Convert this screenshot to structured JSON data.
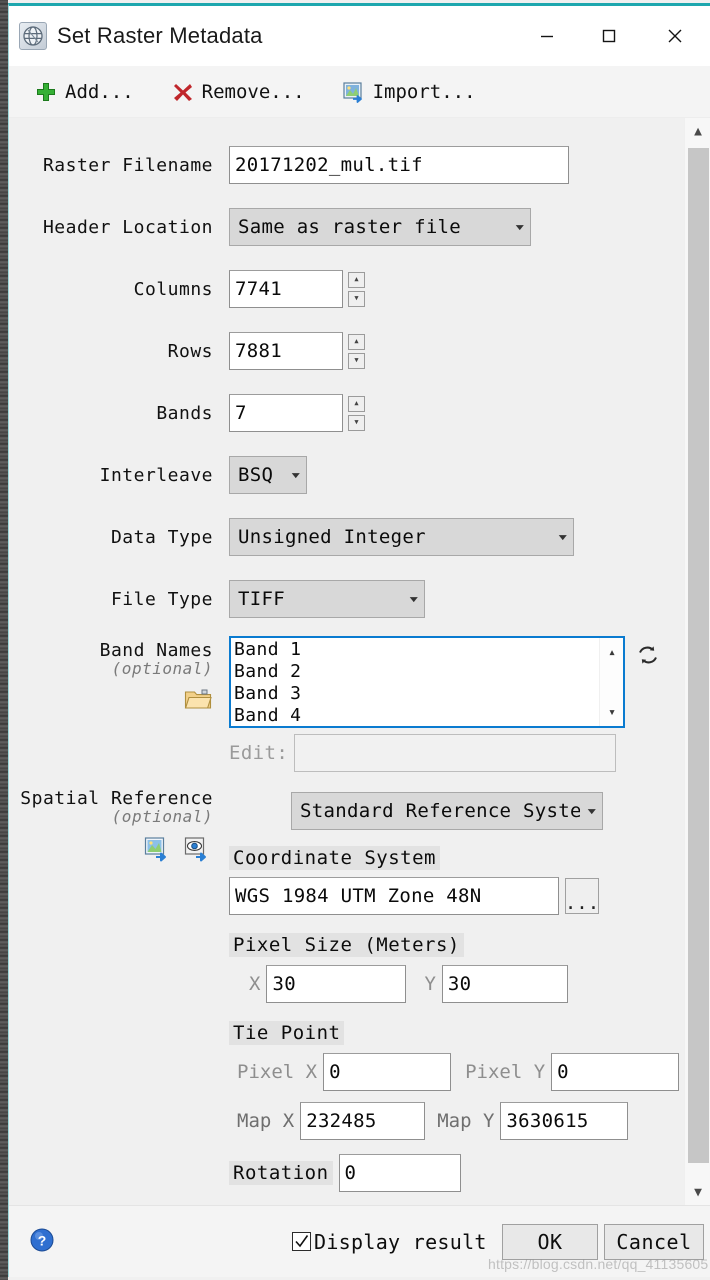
{
  "window": {
    "title": "Set Raster Metadata",
    "app_icon": "envi-globe-icon",
    "minimize": "—",
    "maximize": "□",
    "close": "✕"
  },
  "toolbar": {
    "items": [
      {
        "label": "Add...",
        "icon": "plus-icon"
      },
      {
        "label": "Remove...",
        "icon": "red-x-icon"
      },
      {
        "label": "Import...",
        "icon": "import-image-icon"
      }
    ]
  },
  "form": {
    "raster_filename": {
      "label": "Raster Filename",
      "value": "20171202_mul.tif"
    },
    "header_location": {
      "label": "Header Location",
      "value": "Same as raster file"
    },
    "columns": {
      "label": "Columns",
      "value": "7741"
    },
    "rows": {
      "label": "Rows",
      "value": "7881"
    },
    "bands": {
      "label": "Bands",
      "value": "7"
    },
    "interleave": {
      "label": "Interleave",
      "value": "BSQ"
    },
    "data_type": {
      "label": "Data Type",
      "value": "Unsigned Integer"
    },
    "file_type": {
      "label": "File Type",
      "value": "TIFF"
    },
    "band_names": {
      "label": "Band Names",
      "sublabel": "(optional)",
      "items": [
        "Band 1",
        "Band 2",
        "Band 3",
        "Band 4"
      ],
      "refresh_icon": "refresh-icon",
      "open_folder_icon": "open-folder-icon",
      "edit_label": "Edit:",
      "edit_value": ""
    },
    "spatial_reference": {
      "label": "Spatial Reference",
      "sublabel": "(optional)",
      "mode_value": "Standard Reference System",
      "import_raster_icon": "import-from-raster-icon",
      "import_view_icon": "import-from-view-icon",
      "coordinate_system": {
        "header": "Coordinate System",
        "value": "WGS 1984 UTM Zone 48N",
        "browse_label": "..."
      },
      "pixel_size": {
        "header": "Pixel Size (Meters)",
        "x_label": "X",
        "x_value": "30",
        "y_label": "Y",
        "y_value": "30"
      },
      "tie_point": {
        "header": "Tie Point",
        "pixel_x_label": "Pixel X",
        "pixel_x_value": "0",
        "pixel_y_label": "Pixel Y",
        "pixel_y_value": "0",
        "map_x_label": "Map X",
        "map_x_value": "232485",
        "map_y_label": "Map Y",
        "map_y_value": "3630615"
      },
      "rotation": {
        "header": "Rotation",
        "value": "0"
      }
    }
  },
  "footer": {
    "help_icon": "help-question-icon",
    "display_result_label": "Display result",
    "display_result_checked": true,
    "ok_label": "OK",
    "cancel_label": "Cancel"
  },
  "watermark": {
    "text": "https://blog.csdn.net/qq_41135605"
  },
  "colors": {
    "accent_top": "#1ea7ae",
    "focus_border": "#0a7bd0",
    "dialog_bg": "#f0f0f0",
    "dropdown_bg": "#d8d8d8",
    "section_badge_bg": "#e2e2e2"
  }
}
